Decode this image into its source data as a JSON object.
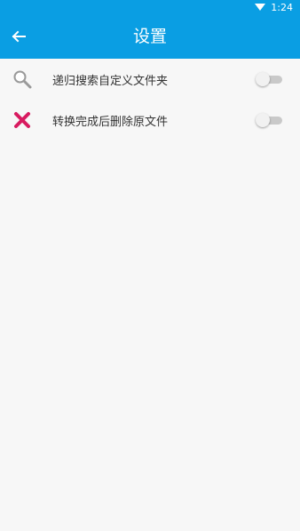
{
  "status_bar": {
    "time": "1:24"
  },
  "app_bar": {
    "title": "设置",
    "back_icon": "arrow-left-icon"
  },
  "settings": [
    {
      "icon": "search-icon",
      "label": "递归搜索自定义文件夹",
      "enabled": false
    },
    {
      "icon": "close-icon",
      "label": "转换完成后删除原文件",
      "enabled": false
    }
  ],
  "colors": {
    "accent": "#0a9ee3",
    "delete_icon": "#d81b60",
    "background": "#f7f7f7"
  }
}
